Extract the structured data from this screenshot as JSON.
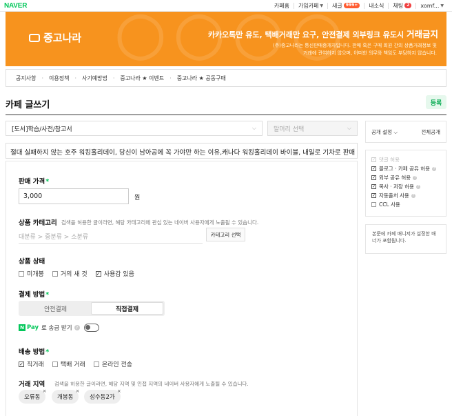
{
  "top": {
    "brand": "NAVER",
    "nav": {
      "cafe_home": "카페홈",
      "joined_cafe": "가입카페",
      "new_posts": "새글",
      "new_count": "999+",
      "my_news": "내소식",
      "chat": "채팅",
      "chat_count": "2",
      "user": "xomf..."
    }
  },
  "banner": {
    "logo": "중고나라",
    "notice_main_prefix": "카카오톡만 유도, 택배거래만 요구, 안전결제 외부링크 유도시 ",
    "notice_main_emph": "거래금지",
    "notice_sub_1": "(주)중고나라는 통신판매중개자입니다. 판매 혹은 구매 회원 간의 상품거래정보 및",
    "notice_sub_2": "거래에 관여하지 않으며, 어떠한 의무와 책임도 부담하지 않습니다."
  },
  "menu": [
    "공지사항",
    "이용정책",
    "사기예방법",
    "중고나라 ★ 이벤트",
    "중고나라 ★ 공동구매"
  ],
  "page": {
    "title": "카페 글쓰기",
    "register": "등록"
  },
  "form": {
    "board": "[도서]학습/사전/참고서",
    "header_placeholder": "말머리 선택",
    "post_title": "절대 실패하지 않는 호주 워킹홀리데이, 당신이 남아공에 꼭 가야만 하는 이유,캐나다 워킹홀리데이 바이블, 내일로 기차로 판매",
    "price_label": "판매 가격",
    "price_value": "3,000",
    "price_unit": "원",
    "category_label": "상품 카테고리",
    "category_hint": "검색을 허용한 글이라면, 해당 카테고리에 관심 있는 네이버 사용자에게 노출될 수 있습니다.",
    "category_placeholder": "대분류 > 중분류 > 소분류",
    "category_button": "카테고리 선택",
    "condition_label": "상품 상태",
    "conditions": [
      {
        "label": "미개봉",
        "checked": false
      },
      {
        "label": "거의 새 것",
        "checked": false
      },
      {
        "label": "사용감 있음",
        "checked": true
      }
    ],
    "payment_label": "결제 방법",
    "payment_options": [
      "안전결제",
      "직접결제"
    ],
    "npay_badge": "N",
    "npay_text": "Pay",
    "npay_suffix": "로 송금 받기",
    "shipping_label": "배송 방법",
    "shipping": [
      {
        "label": "직거래",
        "checked": true
      },
      {
        "label": "택배 거래",
        "checked": false
      },
      {
        "label": "온라인 전송",
        "checked": false
      }
    ],
    "region_label": "거래 지역",
    "region_hint": "검색을 허용한 글이라면, 해당 지역 및 인접 지역의 네이버 사용자에게 노출될 수 있습니다.",
    "regions": [
      "오류동",
      "개봉동",
      "성수동2가"
    ]
  },
  "side": {
    "public_setting": "공개 설정",
    "public_value": "전체공개",
    "options": [
      {
        "label": "댓글 허용",
        "checked": true,
        "disabled": true
      },
      {
        "label": "블로그 · 카페 공유 허용",
        "checked": true,
        "disabled": false
      },
      {
        "label": "외부 공유 허용",
        "checked": true,
        "disabled": false
      },
      {
        "label": "복사 · 저장 허용",
        "checked": true,
        "disabled": false
      },
      {
        "label": "자동출처 사용",
        "checked": true,
        "disabled": false
      },
      {
        "label": "CCL 사용",
        "checked": false,
        "disabled": false
      }
    ],
    "notice": "본문에 카페 매니저가 설정한 배너가 포함됩니다."
  },
  "colors": {
    "naver_green": "#03c75a",
    "banner_orange": "#f7931e"
  }
}
